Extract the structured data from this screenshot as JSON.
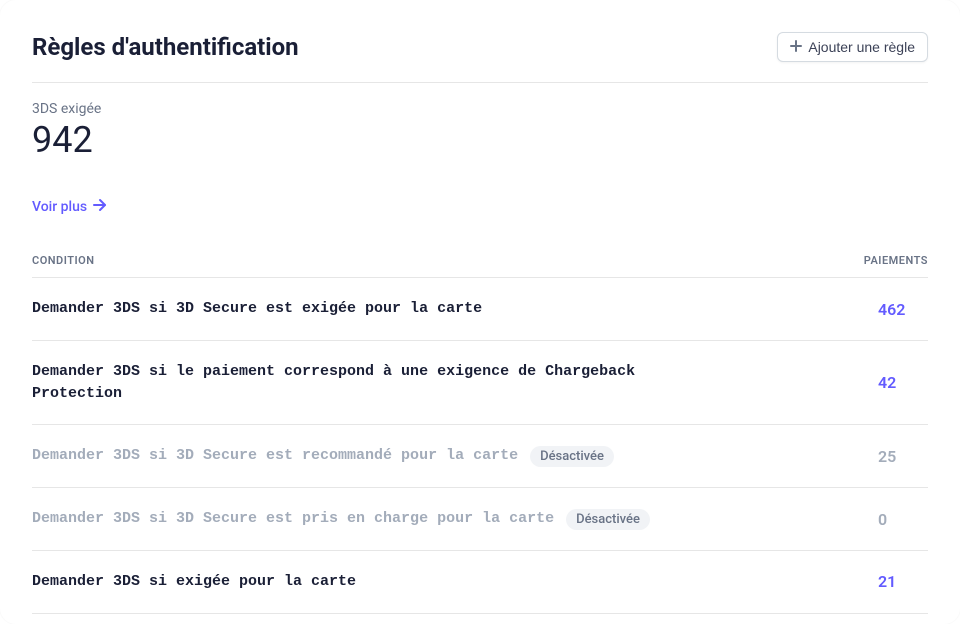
{
  "header": {
    "title": "Règles d'authentification",
    "add_button_label": "Ajouter une règle"
  },
  "summary": {
    "label": "3DS exigée",
    "value": "942"
  },
  "see_more_label": "Voir plus",
  "table": {
    "columns": {
      "condition": "CONDITION",
      "payments": "PAIEMENTS"
    },
    "rows": [
      {
        "condition": "Demander 3DS si 3D Secure est exigée pour la carte",
        "payments": "462",
        "disabled": false,
        "badge": null
      },
      {
        "condition": "Demander 3DS si le paiement correspond à une exigence de Chargeback Protection",
        "payments": "42",
        "disabled": false,
        "badge": null
      },
      {
        "condition": "Demander 3DS si 3D Secure est recommandé pour la carte",
        "payments": "25",
        "disabled": true,
        "badge": "Désactivée"
      },
      {
        "condition": "Demander 3DS si 3D Secure est pris en charge pour la carte",
        "payments": "0",
        "disabled": true,
        "badge": "Désactivée"
      },
      {
        "condition": "Demander 3DS si exigée pour la carte",
        "payments": "21",
        "disabled": false,
        "badge": null
      }
    ]
  }
}
